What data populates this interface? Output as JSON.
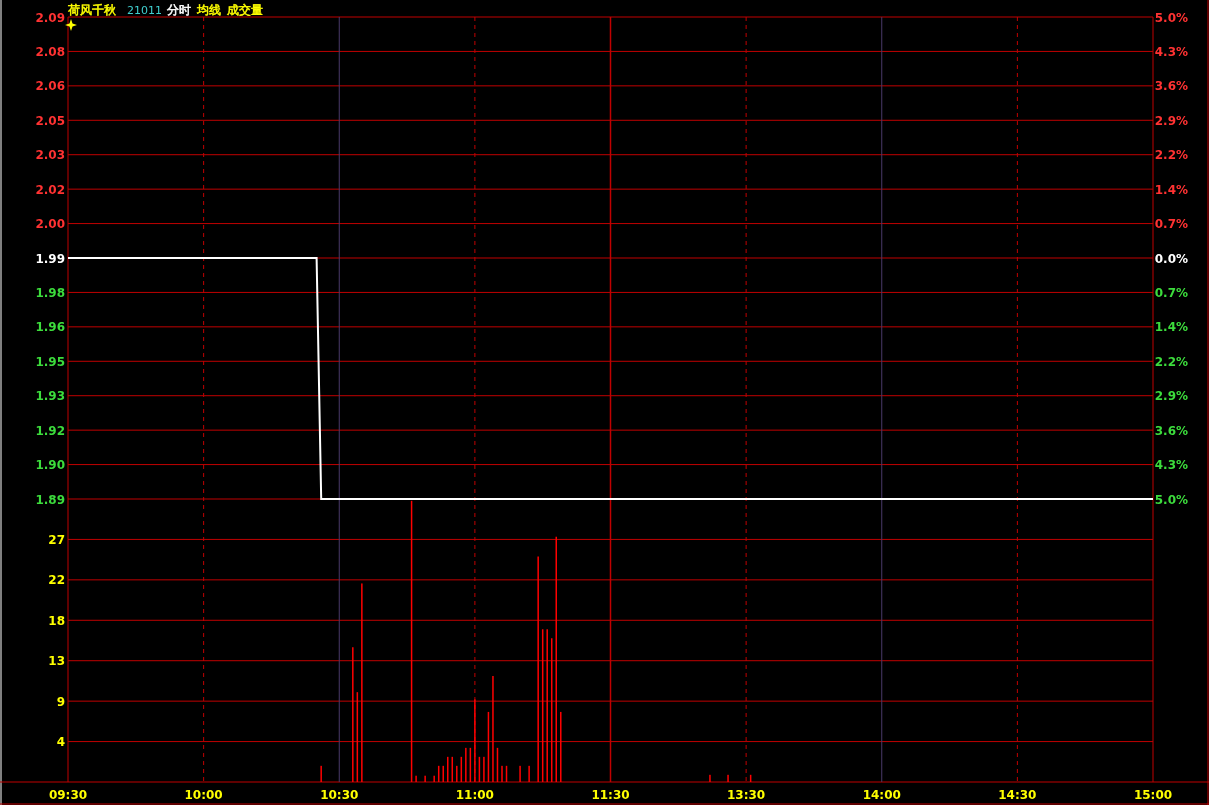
{
  "header": {
    "name": "荷风千秋",
    "code": "21011",
    "indicator": "均线"
  },
  "price": {
    "right_axis": [
      {
        "label": "5.0%",
        "color": "#ff3232"
      },
      {
        "label": "4.3%",
        "color": "#ff3232"
      },
      {
        "label": "3.6%",
        "color": "#ff3232"
      },
      {
        "label": "2.9%",
        "color": "#ff3232"
      },
      {
        "label": "2.2%",
        "color": "#ff3232"
      },
      {
        "label": "1.4%",
        "color": "#ff3232"
      },
      {
        "label": "0.7%",
        "color": "#ff3232"
      },
      {
        "label": "0.0%",
        "color": "#ffffff"
      },
      {
        "label": "0.7%",
        "color": "#3cdc3c"
      },
      {
        "label": "1.4%",
        "color": "#3cdc3c"
      },
      {
        "label": "2.2%",
        "color": "#3cdc3c"
      },
      {
        "label": "2.9%",
        "color": "#3cdc3c"
      },
      {
        "label": "3.6%",
        "color": "#3cdc3c"
      },
      {
        "label": "4.3%",
        "color": "#3cdc3c"
      },
      {
        "label": "5.0%",
        "color": "#3cdc3c"
      }
    ],
    "chart_data": {
      "type": "line",
      "ylim": [
        1.89,
        2.09
      ],
      "categories": [
        null,
        null,
        null,
        null,
        null,
        null,
        null,
        null,
        null,
        null,
        null,
        null,
        null,
        null,
        null,
        null,
        null,
        null,
        null,
        null,
        null,
        null,
        null,
        null,
        null,
        null,
        null,
        null,
        null,
        null,
        null,
        null,
        null,
        null,
        null,
        null,
        null,
        null,
        null,
        null,
        null,
        null,
        null,
        null,
        null,
        null,
        null,
        null,
        null,
        null,
        null,
        null,
        null,
        null,
        null,
        null,
        null,
        null,
        null,
        null,
        null,
        null,
        null,
        null,
        null,
        null,
        null,
        null,
        null,
        null,
        null,
        null,
        null,
        null,
        null,
        null,
        null,
        null,
        null,
        null,
        null,
        null,
        null,
        null,
        null,
        null,
        null,
        null,
        null,
        null,
        null,
        null,
        null,
        null,
        null,
        null,
        null,
        null,
        null,
        null,
        null,
        null,
        null,
        null,
        null,
        null,
        null,
        null,
        null,
        null,
        null,
        null,
        null,
        null,
        null,
        null,
        null,
        null,
        null,
        null,
        null,
        null,
        null,
        null,
        null,
        null,
        null,
        null,
        null,
        null,
        null,
        null,
        null,
        null,
        null,
        null,
        null,
        null,
        null,
        null,
        null,
        null,
        null,
        null,
        null,
        null,
        null,
        null,
        null,
        null,
        null,
        null,
        null,
        null,
        null,
        null,
        null,
        null,
        null,
        null,
        null,
        null,
        null,
        null,
        null,
        null,
        null,
        null,
        null,
        null,
        null,
        null,
        null,
        null,
        null,
        null,
        null,
        null,
        null,
        null,
        null,
        null,
        null,
        null,
        null,
        null,
        null,
        null,
        null,
        null,
        null,
        null,
        null,
        null,
        null,
        null,
        null,
        null,
        null,
        null,
        null,
        null,
        null,
        null,
        null,
        null,
        null,
        null,
        null,
        null,
        null,
        null,
        null,
        null,
        null,
        null,
        null,
        null,
        null,
        null,
        null,
        null,
        null,
        null,
        null,
        null,
        null,
        null,
        null,
        null,
        null,
        null,
        null,
        null,
        null,
        null,
        null,
        null,
        null,
        null,
        null
      ],
      "yticks": [
        {
          "value": 2.09,
          "label": "2.09"
        },
        {
          "value": 2.0757,
          "label": "2.08"
        },
        {
          "value": 2.0614,
          "label": "2.06"
        },
        {
          "value": 2.0471,
          "label": "2.05"
        },
        {
          "value": 2.0329,
          "label": "2.03"
        },
        {
          "value": 2.0186,
          "label": "2.02"
        },
        {
          "value": 2.0043,
          "label": "2.00"
        },
        {
          "value": 1.99,
          "label": "1.99"
        },
        {
          "value": 1.9757,
          "label": "1.98"
        },
        {
          "value": 1.9614,
          "label": "1.96"
        },
        {
          "value": 1.9471,
          "label": "1.95"
        },
        {
          "value": 1.9329,
          "label": "1.93"
        },
        {
          "value": 1.9186,
          "label": "1.92"
        },
        {
          "value": 1.9043,
          "label": "1.90"
        },
        {
          "value": 1.89,
          "label": "1.89"
        }
      ],
      "series": [
        {
          "name": "分时",
          "color": "#ffffff",
          "values": [
            1.99,
            1.99,
            1.99,
            1.99,
            1.99,
            1.99,
            1.99,
            1.99,
            1.99,
            1.99,
            1.99,
            1.99,
            1.99,
            1.99,
            1.99,
            1.99,
            1.99,
            1.99,
            1.99,
            1.99,
            1.99,
            1.99,
            1.99,
            1.99,
            1.99,
            1.99,
            1.99,
            1.99,
            1.99,
            1.99,
            1.99,
            1.99,
            1.99,
            1.99,
            1.99,
            1.99,
            1.99,
            1.99,
            1.99,
            1.99,
            1.99,
            1.99,
            1.99,
            1.99,
            1.99,
            1.99,
            1.99,
            1.99,
            1.99,
            1.99,
            1.99,
            1.99,
            1.99,
            1.99,
            1.99,
            1.99,
            1.89,
            1.89,
            1.89,
            1.89,
            1.89,
            1.89,
            1.89,
            1.89,
            1.89,
            1.89,
            1.89,
            1.89,
            1.89,
            1.89,
            1.89,
            1.89,
            1.89,
            1.89,
            1.89,
            1.89,
            1.89,
            1.89,
            1.89,
            1.89,
            1.89,
            1.89,
            1.89,
            1.89,
            1.89,
            1.89,
            1.89,
            1.89,
            1.89,
            1.89,
            1.89,
            1.89,
            1.89,
            1.89,
            1.89,
            1.89,
            1.89,
            1.89,
            1.89,
            1.89,
            1.89,
            1.89,
            1.89,
            1.89,
            1.89,
            1.89,
            1.89,
            1.89,
            1.89,
            1.89,
            1.89,
            1.89,
            1.89,
            1.89,
            1.89,
            1.89,
            1.89,
            1.89,
            1.89,
            1.89,
            1.89,
            1.89,
            1.89,
            1.89,
            1.89,
            1.89,
            1.89,
            1.89,
            1.89,
            1.89,
            1.89,
            1.89,
            1.89,
            1.89,
            1.89,
            1.89,
            1.89,
            1.89,
            1.89,
            1.89,
            1.89,
            1.89,
            1.89,
            1.89,
            1.89,
            1.89,
            1.89,
            1.89,
            1.89,
            1.89,
            1.89,
            1.89,
            1.89,
            1.89,
            1.89,
            1.89,
            1.89,
            1.89,
            1.89,
            1.89,
            1.89,
            1.89,
            1.89,
            1.89,
            1.89,
            1.89,
            1.89,
            1.89,
            1.89,
            1.89,
            1.89,
            1.89,
            1.89,
            1.89,
            1.89,
            1.89,
            1.89,
            1.89,
            1.89,
            1.89,
            1.89,
            1.89,
            1.89,
            1.89,
            1.89,
            1.89,
            1.89,
            1.89,
            1.89,
            1.89,
            1.89,
            1.89,
            1.89,
            1.89,
            1.89,
            1.89,
            1.89,
            1.89,
            1.89,
            1.89,
            1.89,
            1.89,
            1.89,
            1.89,
            1.89,
            1.89,
            1.89,
            1.89,
            1.89,
            1.89,
            1.89,
            1.89,
            1.89,
            1.89,
            1.89,
            1.89,
            1.89,
            1.89,
            1.89,
            1.89,
            1.89,
            1.89,
            1.89,
            1.89,
            1.89,
            1.89,
            1.89,
            1.89,
            1.89,
            1.89,
            1.89,
            1.89,
            1.89,
            1.89,
            1.89,
            1.89,
            1.89,
            1.89,
            1.89,
            1.89,
            1.89
          ]
        }
      ]
    }
  },
  "volume": {
    "chart_data": {
      "type": "bar",
      "ylim": [
        0,
        31.5
      ],
      "categories": [
        "09:30",
        null,
        null,
        null,
        null,
        null,
        null,
        null,
        null,
        null,
        null,
        null,
        null,
        null,
        null,
        null,
        null,
        null,
        null,
        null,
        null,
        null,
        null,
        null,
        null,
        null,
        null,
        null,
        null,
        null,
        "10:00",
        null,
        null,
        null,
        null,
        null,
        null,
        null,
        null,
        null,
        null,
        null,
        null,
        null,
        null,
        null,
        null,
        null,
        null,
        null,
        null,
        null,
        null,
        null,
        null,
        null,
        null,
        null,
        null,
        null,
        "10:30",
        null,
        null,
        null,
        null,
        null,
        null,
        null,
        null,
        null,
        null,
        null,
        null,
        null,
        null,
        null,
        null,
        null,
        null,
        null,
        null,
        null,
        null,
        null,
        null,
        null,
        null,
        null,
        null,
        null,
        "11:00",
        null,
        null,
        null,
        null,
        null,
        null,
        null,
        null,
        null,
        null,
        null,
        null,
        null,
        null,
        null,
        null,
        null,
        null,
        null,
        null,
        null,
        null,
        null,
        null,
        null,
        null,
        null,
        null,
        null,
        "11:30",
        null,
        null,
        null,
        null,
        null,
        null,
        null,
        null,
        null,
        null,
        null,
        null,
        null,
        null,
        null,
        null,
        null,
        null,
        null,
        null,
        null,
        null,
        null,
        null,
        null,
        null,
        null,
        null,
        null,
        "13:30",
        null,
        null,
        null,
        null,
        null,
        null,
        null,
        null,
        null,
        null,
        null,
        null,
        null,
        null,
        null,
        null,
        null,
        null,
        null,
        null,
        null,
        null,
        null,
        null,
        null,
        null,
        null,
        null,
        null,
        "14:00",
        null,
        null,
        null,
        null,
        null,
        null,
        null,
        null,
        null,
        null,
        null,
        null,
        null,
        null,
        null,
        null,
        null,
        null,
        null,
        null,
        null,
        null,
        null,
        null,
        null,
        null,
        null,
        null,
        null,
        "14:30",
        null,
        null,
        null,
        null,
        null,
        null,
        null,
        null,
        null,
        null,
        null,
        null,
        null,
        null,
        null,
        null,
        null,
        null,
        null,
        null,
        null,
        null,
        null,
        null,
        null,
        null,
        null,
        null,
        null,
        "15:00"
      ],
      "yticks": [
        {
          "value": 4.5,
          "label": "4"
        },
        {
          "value": 9,
          "label": "9"
        },
        {
          "value": 13.5,
          "label": "13"
        },
        {
          "value": 18,
          "label": "18"
        },
        {
          "value": 22.5,
          "label": "22"
        },
        {
          "value": 27,
          "label": "27"
        }
      ],
      "series": [
        {
          "name": "成交量",
          "color": "#ff0000",
          "values": [
            null,
            null,
            null,
            null,
            null,
            null,
            null,
            null,
            null,
            null,
            null,
            null,
            null,
            null,
            null,
            null,
            null,
            null,
            null,
            null,
            null,
            null,
            null,
            null,
            null,
            null,
            null,
            null,
            null,
            null,
            null,
            null,
            null,
            null,
            null,
            null,
            null,
            null,
            null,
            null,
            null,
            null,
            null,
            null,
            null,
            null,
            null,
            null,
            null,
            null,
            null,
            null,
            null,
            null,
            null,
            null,
            1.8,
            null,
            null,
            null,
            null,
            null,
            null,
            15,
            10,
            22.1,
            null,
            null,
            null,
            null,
            null,
            null,
            null,
            null,
            null,
            null,
            31.3,
            0.7,
            null,
            0.7,
            null,
            0.7,
            1.8,
            1.8,
            2.8,
            2.8,
            1.8,
            2.8,
            3.8,
            3.8,
            9.2,
            2.8,
            2.8,
            7.8,
            11.8,
            3.8,
            1.8,
            1.8,
            null,
            null,
            1.8,
            null,
            1.8,
            null,
            25.1,
            17,
            17,
            16,
            27.3,
            7.8,
            null,
            null,
            null,
            null,
            null,
            null,
            null,
            null,
            null,
            null,
            null,
            null,
            null,
            null,
            null,
            null,
            null,
            null,
            null,
            null,
            null,
            null,
            null,
            null,
            null,
            null,
            null,
            null,
            null,
            null,
            null,
            null,
            0.8,
            null,
            null,
            null,
            0.8,
            null,
            null,
            null,
            null,
            0.8,
            null,
            null,
            null,
            null,
            null,
            null,
            null,
            null,
            null,
            null,
            null,
            null,
            null,
            null,
            null,
            null,
            null,
            null,
            null,
            null,
            null,
            null,
            null,
            null,
            null,
            null,
            null,
            null,
            null,
            null,
            null,
            null,
            null,
            null,
            null,
            null,
            null,
            null,
            null,
            null,
            null,
            null,
            null,
            null,
            null,
            null,
            null,
            null,
            null,
            null,
            null,
            null,
            null,
            null,
            null,
            null,
            null,
            null,
            null,
            null,
            null,
            null,
            null,
            null,
            null,
            null,
            null,
            null,
            null,
            null,
            null,
            null,
            null,
            null,
            null,
            null,
            null,
            null,
            null,
            null,
            null,
            null,
            null,
            null,
            null,
            null,
            null,
            null,
            null
          ]
        }
      ]
    }
  }
}
